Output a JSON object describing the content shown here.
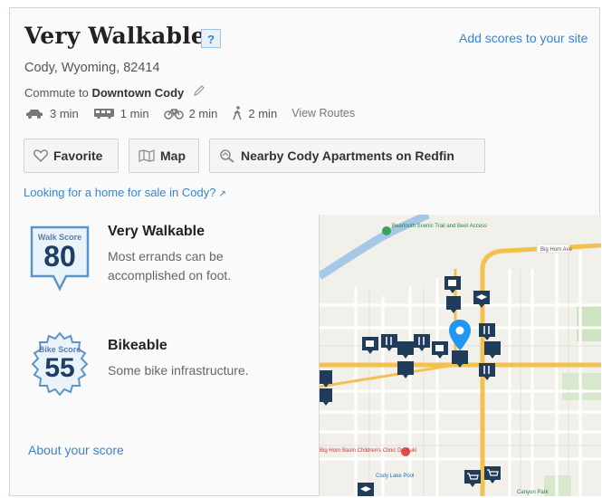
{
  "header": {
    "title": "Very Walkable",
    "help_label": "?",
    "add_scores_link": "Add scores to your site"
  },
  "location": "Cody, Wyoming, 82414",
  "commute": {
    "prefix": "Commute to",
    "destination": "Downtown Cody",
    "modes": [
      {
        "icon": "car-icon",
        "time": "3 min"
      },
      {
        "icon": "bus-icon",
        "time": "1 min"
      },
      {
        "icon": "bike-icon",
        "time": "2 min"
      },
      {
        "icon": "walk-icon",
        "time": "2 min"
      }
    ],
    "view_routes": "View Routes"
  },
  "buttons": {
    "favorite": "Favorite",
    "map": "Map",
    "redfin": "Nearby Cody Apartments on Redfin"
  },
  "home_link": "Looking for a home for sale in Cody?",
  "walk": {
    "badge_label": "Walk Score",
    "score": "80",
    "title": "Very Walkable",
    "desc_line1": "Most errands can be",
    "desc_line2": "accomplished on foot."
  },
  "bike": {
    "badge_label": "Bike Score",
    "score": "55",
    "title": "Bikeable",
    "desc": "Some bike infrastructure."
  },
  "about_link": "About your score",
  "map": {
    "labels": {
      "scenic": "Beartooth Scenic Trail and Beet Access",
      "sign": "Big Horn Ave",
      "beacon": "Big Horn Basin Children's Clinic Dr. Suki",
      "pool": "Cody Lake Pool",
      "park": "Canyon Park"
    }
  },
  "colors": {
    "link": "#3a84c9",
    "badge_border": "#5b95c8",
    "badge_fill": "#eaf2fa",
    "score_number": "#1d3e66",
    "map_pin": "#2196f3",
    "map_poi": "#1f3c5a",
    "map_highway": "#f2c14e"
  }
}
